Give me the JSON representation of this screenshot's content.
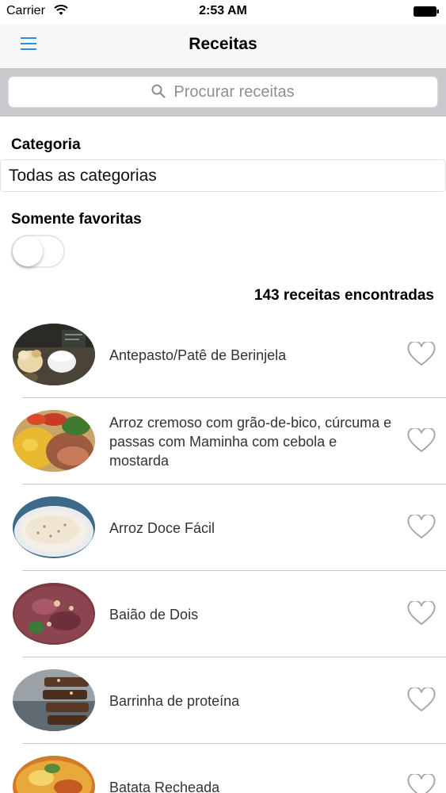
{
  "status_bar": {
    "carrier": "Carrier",
    "time": "2:53 AM"
  },
  "nav": {
    "title": "Receitas",
    "menu_icon": "hamburger-menu-icon"
  },
  "search": {
    "placeholder": "Procurar receitas"
  },
  "filters": {
    "category_label": "Categoria",
    "category_value": "Todas as categorias",
    "favorites_label": "Somente favoritas",
    "favorites_on": false
  },
  "results": {
    "count_text": "143 receitas encontradas"
  },
  "recipes": [
    {
      "name": "Antepasto/Patê de Berinjela",
      "favorite": false
    },
    {
      "name": "Arroz cremoso com grão-de-bico, cúrcuma e passas com Maminha com cebola e mostarda",
      "favorite": false
    },
    {
      "name": "Arroz Doce Fácil",
      "favorite": false
    },
    {
      "name": "Baião de Dois",
      "favorite": false
    },
    {
      "name": "Barrinha de proteína",
      "favorite": false
    },
    {
      "name": "Batata Recheada",
      "favorite": false
    }
  ],
  "colors": {
    "accent": "#2b8de6",
    "nav_bg": "#f7f7f7",
    "search_bar_bg": "#c9c9ce",
    "heart_outline": "#a9a9a9"
  }
}
